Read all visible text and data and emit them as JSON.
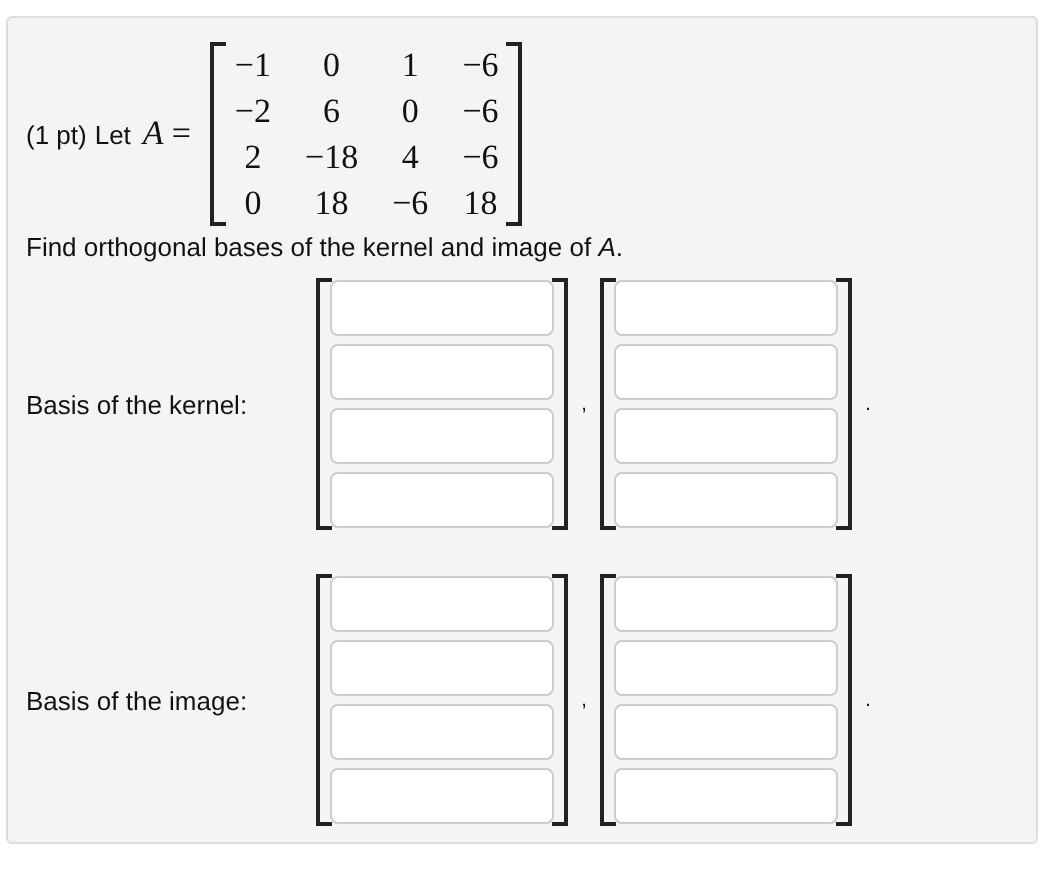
{
  "problem": {
    "points": "(1 pt)",
    "intro": "Let",
    "variable": "A",
    "equals": "=",
    "matrix": [
      [
        "−1",
        "0",
        "1",
        "−6"
      ],
      [
        "−2",
        "6",
        "0",
        "−6"
      ],
      [
        "2",
        "−18",
        "4",
        "−6"
      ],
      [
        "0",
        "18",
        "−6",
        "18"
      ]
    ]
  },
  "question": "Find orthogonal bases of the kernel and image of *A*.",
  "bases": [
    {
      "label": "Basis of the kernel:",
      "vectors": [
        {
          "fields": [
            {
              "kind": "input"
            },
            {
              "kind": "input"
            },
            {
              "kind": "input"
            },
            {
              "kind": "input"
            }
          ],
          "separator": ","
        },
        {
          "fields": [
            {
              "kind": "input"
            },
            {
              "kind": "input"
            },
            {
              "kind": "input"
            },
            {
              "kind": "input"
            }
          ],
          "separator": "."
        }
      ]
    },
    {
      "label": "Basis of the image:",
      "vectors": [
        {
          "fields": [
            {
              "kind": "input"
            },
            {
              "kind": "input"
            },
            {
              "kind": "input"
            },
            {
              "kind": "input"
            }
          ],
          "separator": ","
        },
        {
          "fields": [
            {
              "kind": "input"
            },
            {
              "kind": "input"
            },
            {
              "kind": "input"
            },
            {
              "kind": "input"
            }
          ],
          "separator": "."
        }
      ]
    }
  ]
}
